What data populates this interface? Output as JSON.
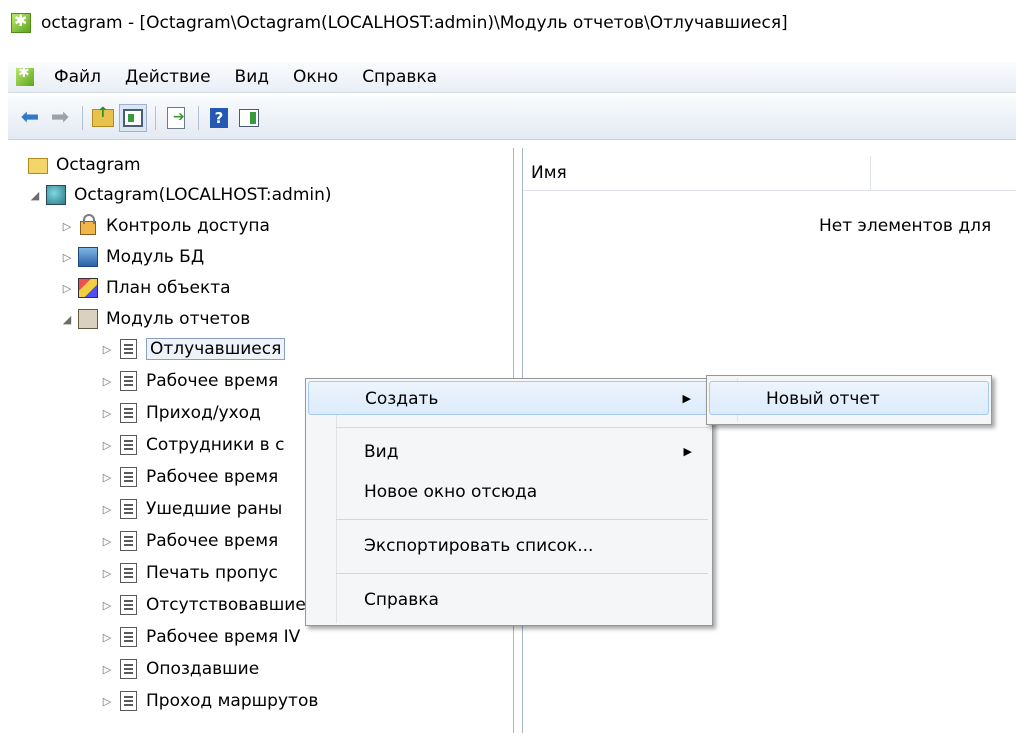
{
  "window": {
    "title": "octagram - [Octagram\\Octagram(LOCALHOST:admin)\\Модуль отчетов\\Отлучавшиеся]"
  },
  "menu": [
    "Файл",
    "Действие",
    "Вид",
    "Окно",
    "Справка"
  ],
  "tree": {
    "root": "Octagram",
    "server": "Octagram(LOCALHOST:admin)",
    "modules": [
      "Контроль доступа",
      "Модуль БД",
      "План объекта",
      "Модуль отчетов"
    ],
    "reports": [
      "Отлучавшиеся",
      "Рабочее время",
      "Приход/уход",
      "Сотрудники в с",
      "Рабочее время",
      "Ушедшие раны",
      "Рабочее время",
      "Печать пропус",
      "Отсутствовавшие",
      "Рабочее время IV",
      "Опоздавшие",
      "Проход маршрутов"
    ]
  },
  "list": {
    "column_name": "Имя",
    "empty_text": "Нет элементов для"
  },
  "context_menu": {
    "items": [
      "Создать",
      "Вид",
      "Новое окно отсюда",
      "Экспортировать список...",
      "Справка"
    ]
  },
  "submenu": {
    "items": [
      "Новый отчет"
    ]
  }
}
